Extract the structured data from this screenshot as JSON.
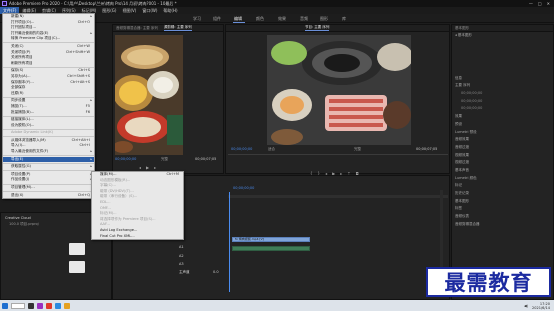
{
  "window": {
    "title": "Adobe Premiere Pro 2020 - C:\\用户\\Desktop\\兰州\\烤肉 Pro\\14 月初\\烤肉?001 - 10最后 *",
    "min": "—",
    "max": "□",
    "close": "✕"
  },
  "menubar": [
    "文件(F)",
    "编辑(E)",
    "剪辑(C)",
    "序列(S)",
    "标记(M)",
    "图形(G)",
    "视图(V)",
    "窗口(W)",
    "帮助(H)"
  ],
  "workspaces": [
    "学习",
    "组件",
    "编辑",
    "颜色",
    "效果",
    "音频",
    "图形",
    "库"
  ],
  "source_panel": {
    "tabs": [
      "效果控件",
      "音频剪辑混合器: 主要 序列",
      "源剪辑: 主要 序列",
      "源 主要"
    ],
    "timecode_left": "00;00;00;00",
    "fit": "完整",
    "timecode_right": "00;00;07;05"
  },
  "program_panel": {
    "tabs": [
      "节目: 主要 序列",
      "节目: 主要 序列"
    ],
    "timecode_left": "00;00;00;00",
    "fit": "适合",
    "full": "完整",
    "timecode_right": "00;00;07;05"
  },
  "right_panel": {
    "tab": "基本图形",
    "items": [
      "◂ 基本图形",
      "信息",
      "主要 序列",
      "00;00;00;00",
      "00;00;00;00",
      "00;00;00;00",
      "主要 序列",
      "00;00;00;00",
      "00;00;00;00",
      "主要 序列",
      "00;00;00;00",
      "00;00;00;00",
      "效果",
      "预设",
      "Lumetri 预设",
      "音频效果",
      "音频过渡",
      "视频效果",
      "视频过渡",
      "基本声音",
      "Lumetri 颜色",
      "标记",
      "历史记录",
      "基本图形",
      "标签",
      "音频仪表",
      "音频剪辑混合器"
    ]
  },
  "file_menu": {
    "items": [
      {
        "label": "新建(N)",
        "shortcut": "",
        "arrow": "▸"
      },
      {
        "label": "打开项目(O)...",
        "shortcut": "Ctrl+O"
      },
      {
        "label": "打开团队项目...",
        "shortcut": ""
      },
      {
        "label": "打开最近使用的内容(E)",
        "shortcut": "",
        "arrow": "▸"
      },
      {
        "label": "转换 Premiere Clip 项目(C)...",
        "shortcut": ""
      },
      {
        "sep": true
      },
      {
        "label": "关闭(C)",
        "shortcut": "Ctrl+W"
      },
      {
        "label": "关闭项目(P)",
        "shortcut": "Ctrl+Shift+W"
      },
      {
        "label": "关闭所有项目",
        "shortcut": ""
      },
      {
        "label": "刷新所有项目",
        "shortcut": ""
      },
      {
        "sep": true
      },
      {
        "label": "保存(S)",
        "shortcut": "Ctrl+S"
      },
      {
        "label": "另存为(A)...",
        "shortcut": "Ctrl+Shift+S"
      },
      {
        "label": "保存副本(Y)...",
        "shortcut": "Ctrl+Alt+S"
      },
      {
        "label": "全部保存",
        "shortcut": ""
      },
      {
        "label": "还原(R)",
        "shortcut": ""
      },
      {
        "sep": true
      },
      {
        "label": "同步设置",
        "shortcut": "",
        "arrow": "▸"
      },
      {
        "label": "捕捉(T)...",
        "shortcut": "F5"
      },
      {
        "label": "批量捕捉(B)...",
        "shortcut": "F6"
      },
      {
        "sep": true
      },
      {
        "label": "链接媒体(L)...",
        "shortcut": ""
      },
      {
        "label": "设为脱机(O)...",
        "shortcut": ""
      },
      {
        "sep": true
      },
      {
        "label": "Adobe Dynamic Link(K)",
        "shortcut": "",
        "disabled": true
      },
      {
        "sep": true
      },
      {
        "label": "从媒体浏览器导入(M)",
        "shortcut": "Ctrl+Alt+I"
      },
      {
        "label": "导入(I)...",
        "shortcut": "Ctrl+I"
      },
      {
        "label": "导入最近使用的文件(F)",
        "shortcut": "",
        "arrow": "▸"
      },
      {
        "sep": true
      },
      {
        "label": "导出(E)",
        "shortcut": "",
        "arrow": "▸",
        "hl": true
      },
      {
        "sep": true
      },
      {
        "label": "获取属性(G)",
        "shortcut": "",
        "arrow": "▸"
      },
      {
        "sep": true
      },
      {
        "label": "项目设置(P)",
        "shortcut": "",
        "arrow": "▸"
      },
      {
        "label": "作品设置(J)",
        "shortcut": "",
        "arrow": "▸"
      },
      {
        "sep": true
      },
      {
        "label": "项目管理(M)...",
        "shortcut": ""
      },
      {
        "sep": true
      },
      {
        "label": "退出(X)",
        "shortcut": "Ctrl+Q"
      }
    ]
  },
  "export_submenu": {
    "items": [
      {
        "label": "媒体(M)...",
        "shortcut": "Ctrl+M"
      },
      {
        "label": "动态图形模板(R)...",
        "shortcut": "",
        "disabled": true
      },
      {
        "label": "字幕(C)...",
        "shortcut": "",
        "disabled": true
      },
      {
        "label": "磁带 (DV/HDV)(T)...",
        "shortcut": "",
        "disabled": true
      },
      {
        "label": "磁带（串行设备）(S)...",
        "shortcut": "",
        "disabled": true
      },
      {
        "label": "EDL...",
        "shortcut": "",
        "disabled": true
      },
      {
        "label": "OMF...",
        "shortcut": "",
        "disabled": true
      },
      {
        "label": "标记(M)...",
        "shortcut": "",
        "disabled": true
      },
      {
        "label": "将选择项作为 Premiere 项目(S)...",
        "shortcut": "",
        "disabled": true
      },
      {
        "label": "AAF...",
        "shortcut": "",
        "disabled": true
      },
      {
        "label": "Avid Log Exchange...",
        "shortcut": ""
      },
      {
        "label": "Final Cut Pro XML...",
        "shortcut": ""
      }
    ]
  },
  "timeline": {
    "timecode": "00;00;00;00",
    "tracks": [
      "V3",
      "V2",
      "V1",
      "A1",
      "A2",
      "A3",
      "主声道"
    ],
    "clip_label": "fx 烤肉视频.mp4 [V]",
    "master_value": "0.0"
  },
  "project_panel": {
    "label": "Creative Cloud",
    "item": "100.0 项目.prproj"
  },
  "taskbar": {
    "time": "17:20",
    "date": "2021/6/14"
  },
  "watermark": "最需教育"
}
